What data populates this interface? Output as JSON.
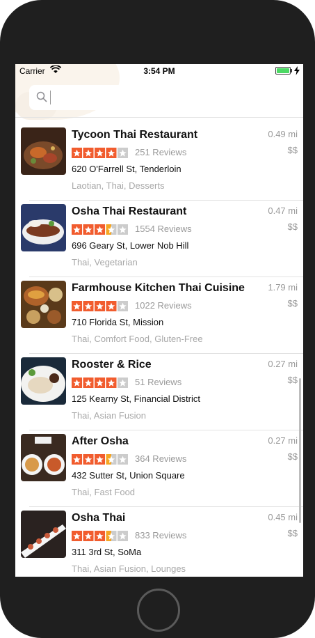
{
  "status_bar": {
    "carrier": "Carrier",
    "time": "3:54 PM"
  },
  "search": {
    "placeholder": ""
  },
  "restaurants": [
    {
      "name": "Tycoon Thai Restaurant",
      "distance": "0.49 mi",
      "price": "$$",
      "rating": 4,
      "reviews": "251 Reviews",
      "address": "620 O'Farrell St, Tenderloin",
      "categories": "Laotian, Thai, Desserts"
    },
    {
      "name": "Osha Thai Restaurant",
      "distance": "0.47 mi",
      "price": "$$",
      "rating": 3.5,
      "reviews": "1554 Reviews",
      "address": "696 Geary St, Lower Nob Hill",
      "categories": "Thai, Vegetarian"
    },
    {
      "name": "Farmhouse Kitchen Thai Cuisine",
      "distance": "1.79 mi",
      "price": "$$",
      "rating": 4,
      "reviews": "1022 Reviews",
      "address": "710 Florida St, Mission",
      "categories": "Thai, Comfort Food, Gluten-Free"
    },
    {
      "name": "Rooster & Rice",
      "distance": "0.27 mi",
      "price": "$$",
      "rating": 4,
      "reviews": "51 Reviews",
      "address": "125 Kearny St, Financial District",
      "categories": "Thai, Asian Fusion"
    },
    {
      "name": "After Osha",
      "distance": "0.27 mi",
      "price": "$$",
      "rating": 3.5,
      "reviews": "364 Reviews",
      "address": "432 Sutter St, Union Square",
      "categories": "Thai, Fast Food"
    },
    {
      "name": "Osha Thai",
      "distance": "0.45 mi",
      "price": "$$",
      "rating": 3.5,
      "reviews": "833 Reviews",
      "address": "311 3rd St, SoMa",
      "categories": "Thai, Asian Fusion, Lounges"
    }
  ],
  "colors": {
    "star_on": "#f15c2e",
    "star_half": "#f5a623",
    "star_off": "#cccccc",
    "battery": "#4cd964"
  },
  "icons": {
    "search": "search-icon",
    "wifi": "wifi-icon",
    "battery": "battery-icon",
    "charging": "bolt-icon",
    "star": "star-icon"
  }
}
